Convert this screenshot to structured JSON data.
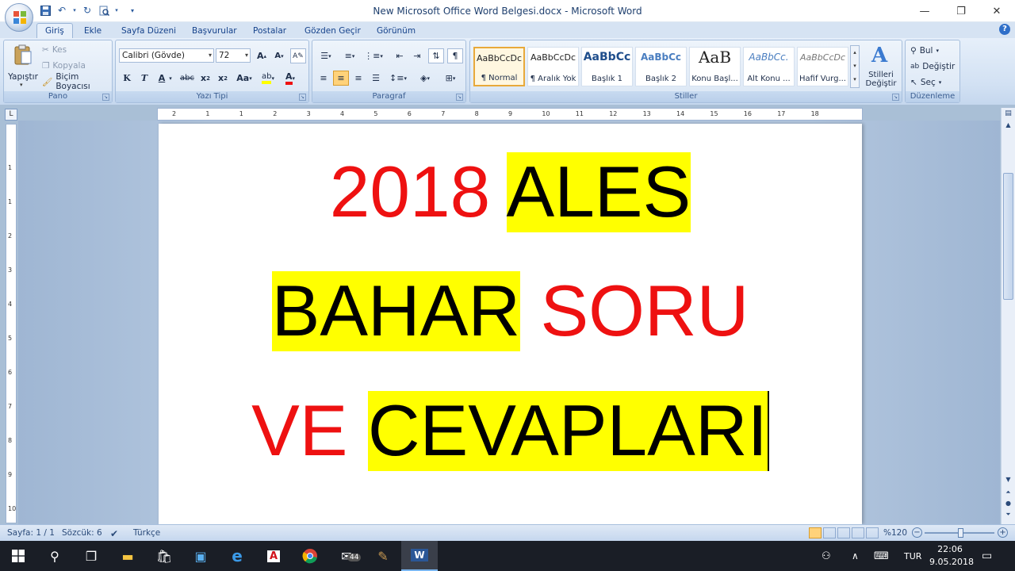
{
  "window": {
    "title": "New Microsoft Office Word Belgesi.docx - Microsoft Word"
  },
  "tabs": [
    {
      "label": "Giriş",
      "active": true
    },
    {
      "label": "Ekle"
    },
    {
      "label": "Sayfa Düzeni"
    },
    {
      "label": "Başvurular"
    },
    {
      "label": "Postalar"
    },
    {
      "label": "Gözden Geçir"
    },
    {
      "label": "Görünüm"
    }
  ],
  "ribbon": {
    "pano": {
      "label": "Pano",
      "paste": "Yapıştır",
      "cut": "Kes",
      "copy": "Kopyala",
      "format_painter": "Biçim Boyacısı"
    },
    "font": {
      "label": "Yazı Tipi",
      "font_name": "Calibri (Gövde)",
      "font_size": "72"
    },
    "paragraph": {
      "label": "Paragraf"
    },
    "styles": {
      "label": "Stiller",
      "items": [
        {
          "sample": "AaBbCcDc",
          "name": "¶ Normal"
        },
        {
          "sample": "AaBbCcDc",
          "name": "¶ Aralık Yok"
        },
        {
          "sample": "AaBbCc",
          "name": "Başlık 1"
        },
        {
          "sample": "AaBbCc",
          "name": "Başlık 2"
        },
        {
          "sample": "AaB",
          "name": "Konu Başl..."
        },
        {
          "sample": "AaBbCc.",
          "name": "Alt Konu ..."
        },
        {
          "sample": "AaBbCcDc",
          "name": "Hafif Vurg..."
        }
      ],
      "change_styles": "Stilleri Değiştir"
    },
    "editing": {
      "label": "Düzenleme",
      "find": "Bul",
      "replace": "Değiştir",
      "select": "Seç"
    }
  },
  "document": {
    "line1": {
      "year": "2018",
      "word": "ALES"
    },
    "line2": {
      "word1": "BAHAR",
      "word2": "SORU"
    },
    "line3": {
      "word1": "VE",
      "word2": "CEVAPLARI"
    },
    "colors": {
      "red": "#ee1111",
      "highlight": "#ffff00"
    }
  },
  "ruler": {
    "h_ticks": [
      "2",
      "1",
      "1",
      "2",
      "3",
      "4",
      "5",
      "6",
      "7",
      "8",
      "9",
      "10",
      "11",
      "12",
      "13",
      "14",
      "15",
      "16",
      "17",
      "18"
    ],
    "v_ticks": [
      "1",
      "1",
      "2",
      "3",
      "4",
      "5",
      "6",
      "7",
      "8",
      "9",
      "10",
      "11"
    ]
  },
  "status": {
    "page": "Sayfa: 1 / 1",
    "words": "Sözcük: 6",
    "language": "Türkçe",
    "zoom": "%120"
  },
  "taskbar": {
    "mail_badge": "44",
    "language": "TUR",
    "time": "22:06",
    "date": "9.05.2018"
  }
}
